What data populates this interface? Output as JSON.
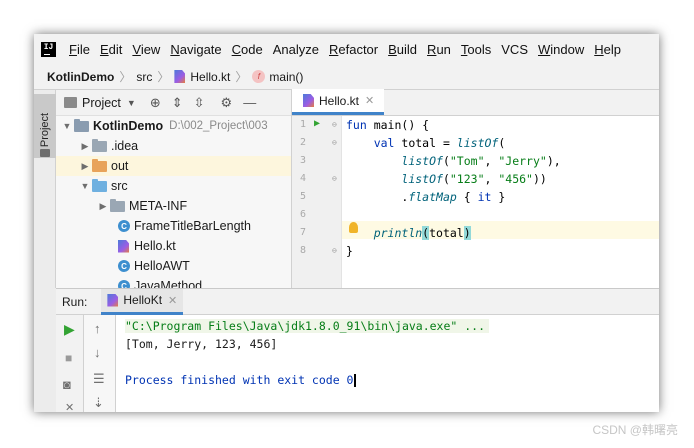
{
  "menubar": {
    "logo_text": "IJ",
    "items": [
      {
        "label": "File",
        "underline": "F",
        "rest": "ile"
      },
      {
        "label": "Edit",
        "underline": "E",
        "rest": "dit"
      },
      {
        "label": "View",
        "underline": "V",
        "rest": "iew"
      },
      {
        "label": "Navigate",
        "underline": "N",
        "rest": "avigate"
      },
      {
        "label": "Code",
        "underline": "C",
        "rest": "ode"
      },
      {
        "label": "Analyze",
        "underline": "",
        "rest": "Analyze"
      },
      {
        "label": "Refactor",
        "underline": "R",
        "rest": "efactor"
      },
      {
        "label": "Build",
        "underline": "B",
        "rest": "uild"
      },
      {
        "label": "Run",
        "underline": "R",
        "rest": "un"
      },
      {
        "label": "Tools",
        "underline": "T",
        "rest": "ools"
      },
      {
        "label": "VCS",
        "underline": "",
        "rest": "VCS"
      },
      {
        "label": "Window",
        "underline": "W",
        "rest": "indow"
      },
      {
        "label": "Help",
        "underline": "H",
        "rest": "elp"
      }
    ]
  },
  "breadcrumb": {
    "project": "KotlinDemo",
    "folder": "src",
    "file": "Hello.kt",
    "function": "main()"
  },
  "side_tab": {
    "label": "Project"
  },
  "project_panel": {
    "title": "Project",
    "tree": [
      {
        "label": "KotlinDemo",
        "path": "D:\\002_Project\\003",
        "type": "root",
        "arrow": "down"
      },
      {
        "label": ".idea",
        "type": "folder-grey",
        "arrow": "right"
      },
      {
        "label": "out",
        "type": "folder-orange",
        "arrow": "right"
      },
      {
        "label": "src",
        "type": "folder-blue",
        "arrow": "down"
      },
      {
        "label": "META-INF",
        "type": "folder-grey",
        "arrow": "right"
      },
      {
        "label": "FrameTitleBarLength",
        "type": "class"
      },
      {
        "label": "Hello.kt",
        "type": "kotlin"
      },
      {
        "label": "HelloAWT",
        "type": "class"
      },
      {
        "label": "JavaMethod",
        "type": "class"
      }
    ]
  },
  "editor": {
    "tab_label": "Hello.kt",
    "line_numbers": [
      "1",
      "2",
      "3",
      "4",
      "5",
      "6",
      "7",
      "8"
    ],
    "code": {
      "l1_kw": "fun",
      "l1_rest": " main() {",
      "l2_indent": "    ",
      "l2_kw": "val",
      "l2_mid": " total = ",
      "l2_fn": "listOf",
      "l2_end": "(",
      "l3_indent": "        ",
      "l3_fn": "listOf",
      "l3_open": "(",
      "l3_s1": "\"Tom\"",
      "l3_sep": ", ",
      "l3_s2": "\"Jerry\"",
      "l3_close": "),",
      "l4_indent": "        ",
      "l4_fn": "listOf",
      "l4_open": "(",
      "l4_s1": "\"123\"",
      "l4_sep": ", ",
      "l4_s2": "\"456\"",
      "l4_close": "))",
      "l5_indent": "        ",
      "l5_dot": ".",
      "l5_fn": "flatMap",
      "l5_open": " { ",
      "l5_it": "it",
      "l5_close": " }",
      "l7_indent": "    ",
      "l7_fn": "println",
      "l7_open": "(",
      "l7_arg": "total",
      "l7_close": ")",
      "l8": "}"
    }
  },
  "run_panel": {
    "label": "Run:",
    "tab_label": "HelloKt",
    "console": {
      "cmd": "\"C:\\Program Files\\Java\\jdk1.8.0_91\\bin\\java.exe\" ...",
      "output": "[Tom, Jerry, 123, 456]",
      "exit": "Process finished with exit code 0"
    }
  },
  "watermark": "CSDN @韩曙亮"
}
